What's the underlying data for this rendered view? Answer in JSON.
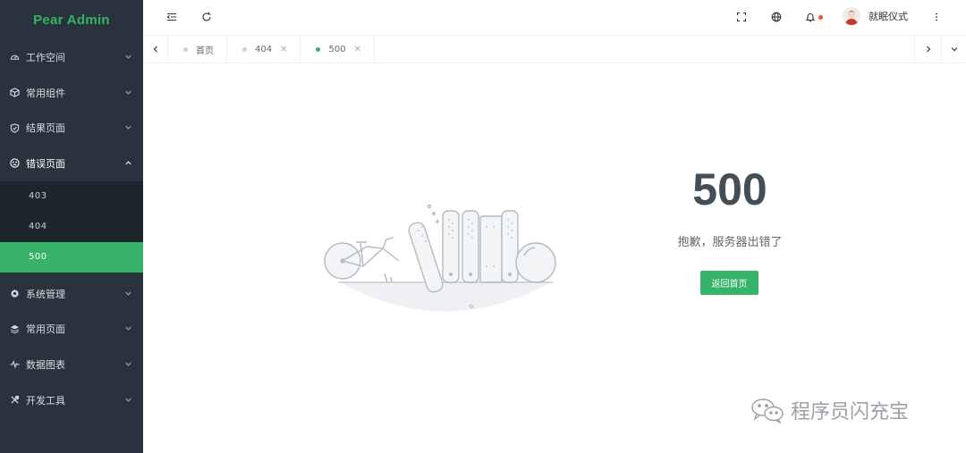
{
  "app": {
    "logo": "Pear Admin"
  },
  "sidebar": {
    "items": [
      {
        "label": "工作空间",
        "icon": "dashboard-icon"
      },
      {
        "label": "常用组件",
        "icon": "cube-icon"
      },
      {
        "label": "结果页面",
        "icon": "shield-icon"
      },
      {
        "label": "错误页面",
        "icon": "sad-face-icon",
        "open": true
      },
      {
        "label": "系统管理",
        "icon": "gear-icon"
      },
      {
        "label": "常用页面",
        "icon": "layers-icon"
      },
      {
        "label": "数据图表",
        "icon": "pulse-icon"
      },
      {
        "label": "开发工具",
        "icon": "tools-icon"
      }
    ],
    "submenu": [
      {
        "label": "403"
      },
      {
        "label": "404"
      },
      {
        "label": "500",
        "active": true
      }
    ]
  },
  "header": {
    "user_name": "就眠仪式",
    "icons": [
      "menu-collapse-icon",
      "refresh-icon",
      "fullscreen-icon",
      "globe-icon",
      "bell-icon",
      "more-vertical-icon"
    ]
  },
  "tabs": [
    {
      "label": "首页",
      "closable": false
    },
    {
      "label": "404",
      "closable": true
    },
    {
      "label": "500",
      "closable": true,
      "active": true
    }
  ],
  "error": {
    "code": "500",
    "message": "抱歉，服务器出错了",
    "button": "返回首页"
  },
  "watermark": {
    "text": "程序员闪充宝"
  },
  "colors": {
    "accent": "#36b368",
    "sidebar": "#28333e",
    "submenu": "#1e252c",
    "badge": "#f5532d"
  }
}
